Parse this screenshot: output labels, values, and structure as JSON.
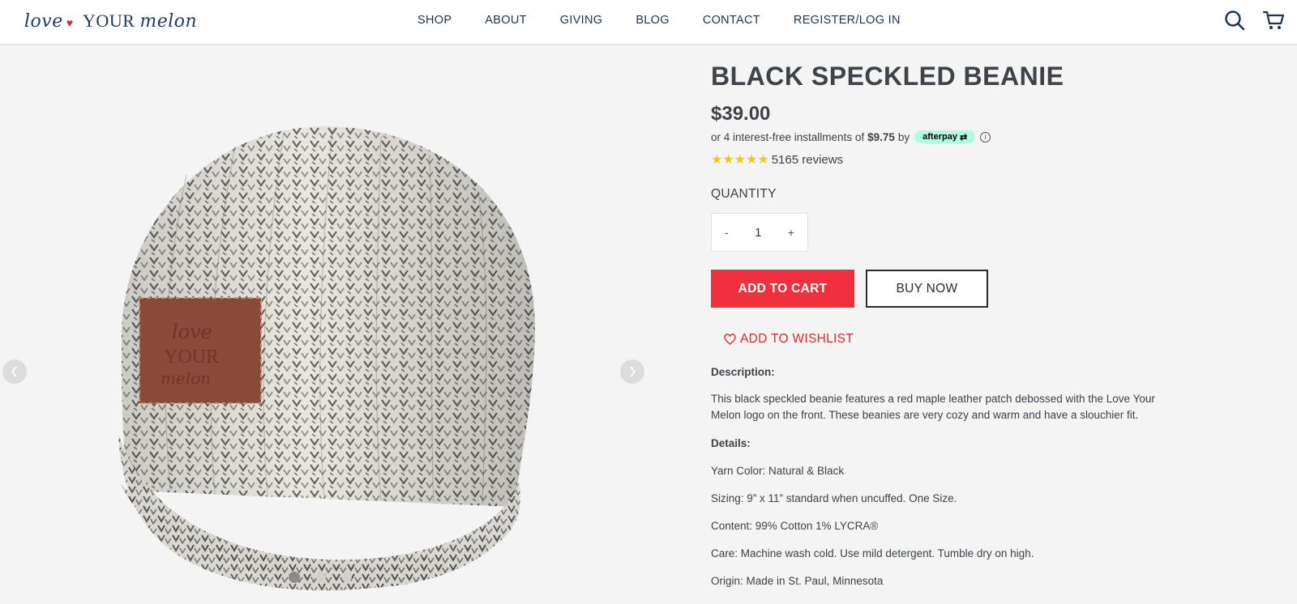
{
  "header": {
    "logo": {
      "love": "love",
      "your": "YOUR",
      "melon": "melon"
    },
    "nav": [
      "SHOP",
      "ABOUT",
      "GIVING",
      "BLOG",
      "CONTACT",
      "REGISTER/LOG IN"
    ],
    "icons": [
      "search-icon",
      "cart-icon"
    ]
  },
  "gallery": {
    "slide_count": 3,
    "active_slide": 1,
    "patch_text": {
      "love": "love",
      "your": "YOUR",
      "melon": "melon"
    }
  },
  "product": {
    "title": "BLACK SPECKLED BEANIE",
    "price": "$39.00",
    "afterpay": {
      "prefix": "or 4 interest-free installments of",
      "amount": "$9.75",
      "by": "by",
      "brand": "afterpay"
    },
    "rating": {
      "stars": 5,
      "reviews": "5165 reviews"
    },
    "quantity": {
      "label": "QUANTITY",
      "minus": "-",
      "value": "1",
      "plus": "+"
    },
    "buttons": {
      "add_to_cart": "ADD TO CART",
      "buy_now": "BUY NOW",
      "wishlist": "ADD TO WISHLIST"
    },
    "description_heading": "Description:",
    "description": "This black speckled beanie features a red maple leather patch debossed with the Love Your Melon logo on the front. These beanies are very cozy and warm and have a slouchier fit.",
    "details_heading": "Details:",
    "details": [
      "Yarn Color: Natural & Black",
      "Sizing: 9” x 11” standard when uncuffed. One Size.",
      "Content: 99% Cotton 1% LYCRA®",
      "Care: Machine wash cold. Use mild detergent. Tumble dry on high.",
      "Origin: Made in St. Paul, Minnesota"
    ]
  },
  "colors": {
    "accent_red": "#f0303e",
    "nav_navy": "#1f3350",
    "afterpay_mint": "#b2fce4",
    "star_gold": "#f5c518"
  }
}
